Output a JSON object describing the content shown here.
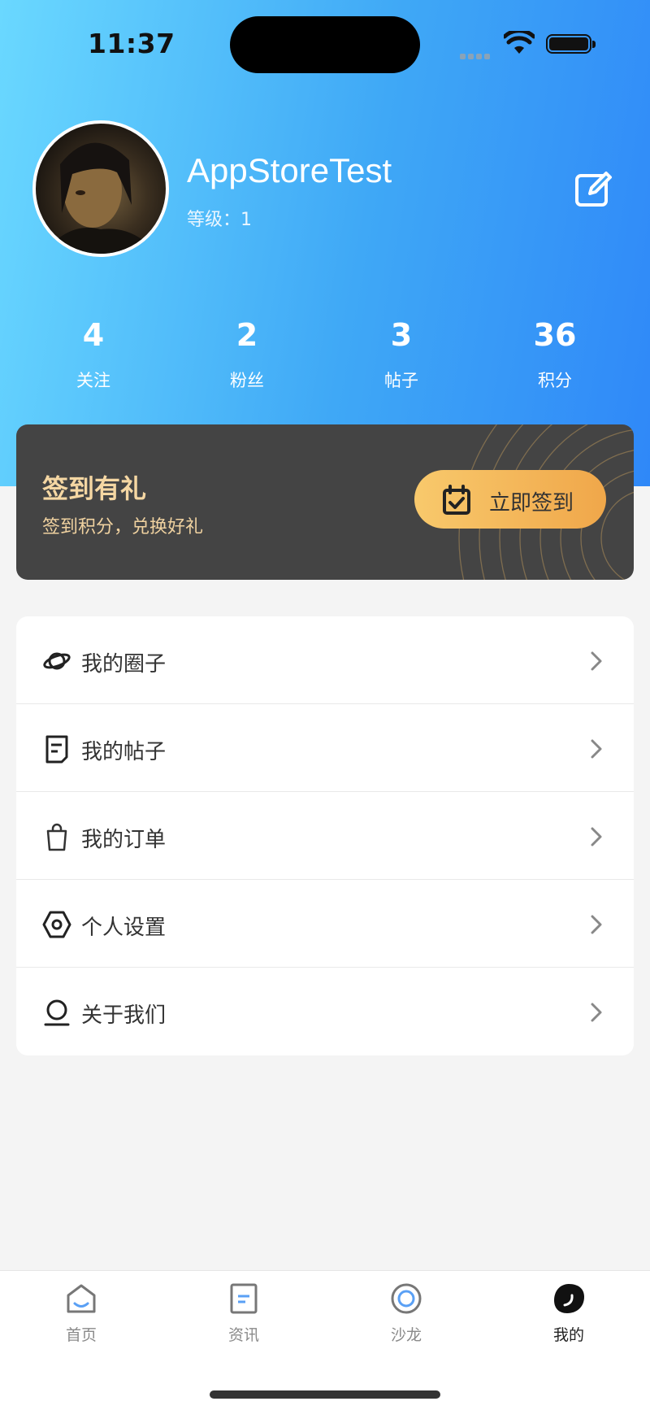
{
  "status": {
    "time": "11:37"
  },
  "profile": {
    "username": "AppStoreTest",
    "level_label": "等级：",
    "level_value": "1"
  },
  "stats": [
    {
      "value": "4",
      "label": "关注"
    },
    {
      "value": "2",
      "label": "粉丝"
    },
    {
      "value": "3",
      "label": "帖子"
    },
    {
      "value": "36",
      "label": "积分"
    }
  ],
  "signin": {
    "title": "签到有礼",
    "subtitle": "签到积分，兑换好礼",
    "button": "立即签到"
  },
  "menu": [
    {
      "label": "我的圈子",
      "icon": "planet-icon"
    },
    {
      "label": "我的帖子",
      "icon": "document-icon"
    },
    {
      "label": "我的订单",
      "icon": "shopping-bag-icon"
    },
    {
      "label": "个人设置",
      "icon": "settings-hexagon-icon"
    },
    {
      "label": "关于我们",
      "icon": "person-icon"
    }
  ],
  "tabs": [
    {
      "label": "首页",
      "icon": "home-icon",
      "active": false
    },
    {
      "label": "资讯",
      "icon": "news-icon",
      "active": false
    },
    {
      "label": "沙龙",
      "icon": "salon-circle-icon",
      "active": false
    },
    {
      "label": "我的",
      "icon": "profile-icon",
      "active": true
    }
  ],
  "colors": {
    "hero_gradient_start": "#6ad8ff",
    "hero_gradient_end": "#2f88f8",
    "signin_card": "#444444",
    "signin_text": "#f5d7a3",
    "signin_button_start": "#f8c96c",
    "signin_button_end": "#f0a74a"
  }
}
